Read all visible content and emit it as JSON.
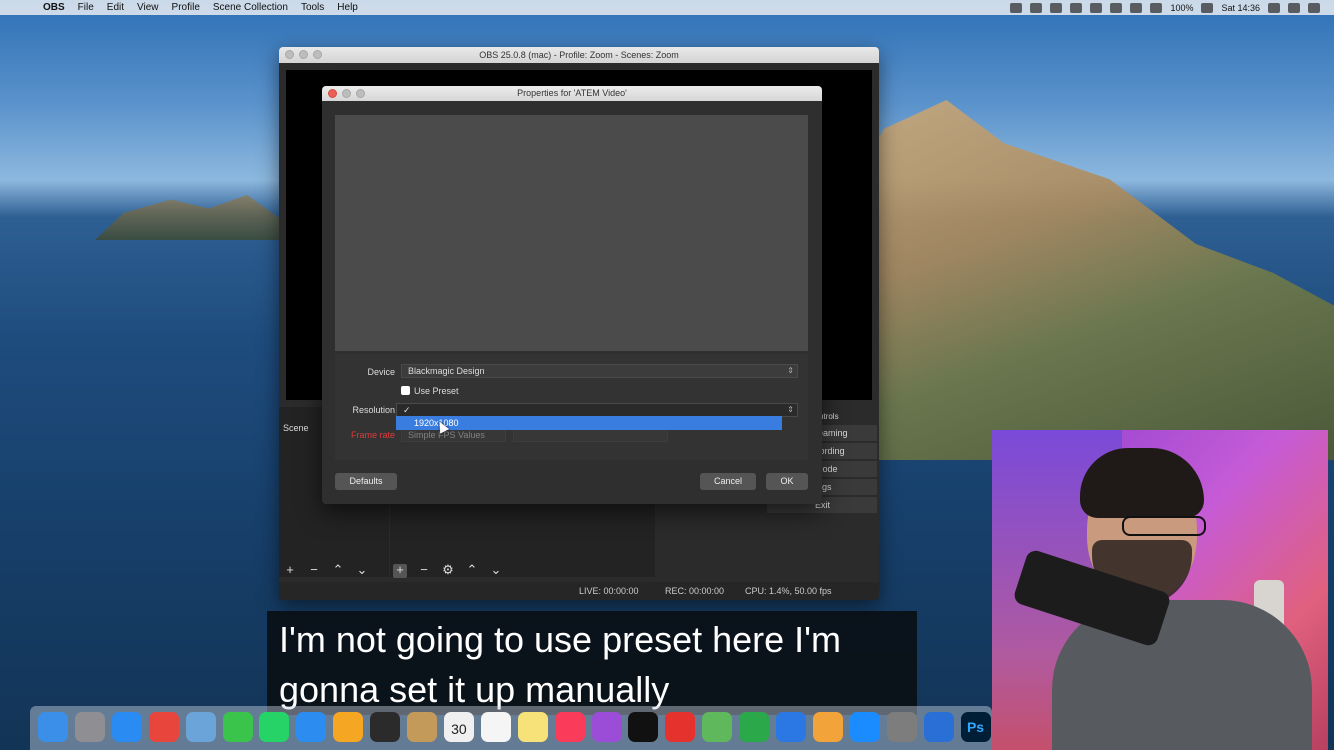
{
  "menubar": {
    "app_name": "OBS",
    "items": [
      "File",
      "Edit",
      "View",
      "Profile",
      "Scene Collection",
      "Tools",
      "Help"
    ],
    "battery": "100%",
    "clock": "Sat 14:36"
  },
  "obs_window": {
    "title": "OBS 25.0.8 (mac) - Profile: Zoom - Scenes: Zoom",
    "scenes_header": "Scene",
    "controls": {
      "header": "ntrols",
      "buttons": [
        "reaming",
        "cording",
        "Mode",
        "ings",
        "Exit"
      ]
    },
    "status": {
      "live": "LIVE: 00:00:00",
      "rec": "REC: 00:00:00",
      "cpu": "CPU: 1.4%, 50.00 fps"
    }
  },
  "properties_dialog": {
    "title": "Properties for 'ATEM Video'",
    "device_label": "Device",
    "device_value": "Blackmagic Design",
    "use_preset_label": "Use Preset",
    "resolution_label": "Resolution",
    "resolution_value": "✓",
    "frame_rate_label": "Frame rate",
    "frame_rate_value": "Simple FPS Values",
    "dropdown_option": "1920x1080",
    "defaults_button": "Defaults",
    "cancel_button": "Cancel",
    "ok_button": "OK"
  },
  "subtitle": {
    "line1": "I'm not going to use preset here I'm",
    "line2": "gonna set it up manually"
  },
  "dock": {
    "icons": [
      "finder-icon",
      "launchpad-icon",
      "safari-icon",
      "chrome-icon",
      "preview-icon",
      "facetime-icon",
      "whatsapp-icon",
      "messages-icon",
      "photos-icon",
      "final-cut-icon",
      "contacts-icon",
      "calendar-icon",
      "reminders-icon",
      "notes-icon",
      "music-icon",
      "podcasts-icon",
      "apple-tv-icon",
      "news-icon",
      "maps-icon",
      "numbers-icon",
      "keynote-icon",
      "pages-icon",
      "app-store-icon",
      "system-preferences-icon",
      "logic-icon",
      "photoshop-icon"
    ],
    "calendar_day": "30",
    "photoshop_label": "Ps"
  },
  "colors": {
    "accent_blue": "#3a7de0",
    "frame_rate_red": "#e03a3a"
  }
}
